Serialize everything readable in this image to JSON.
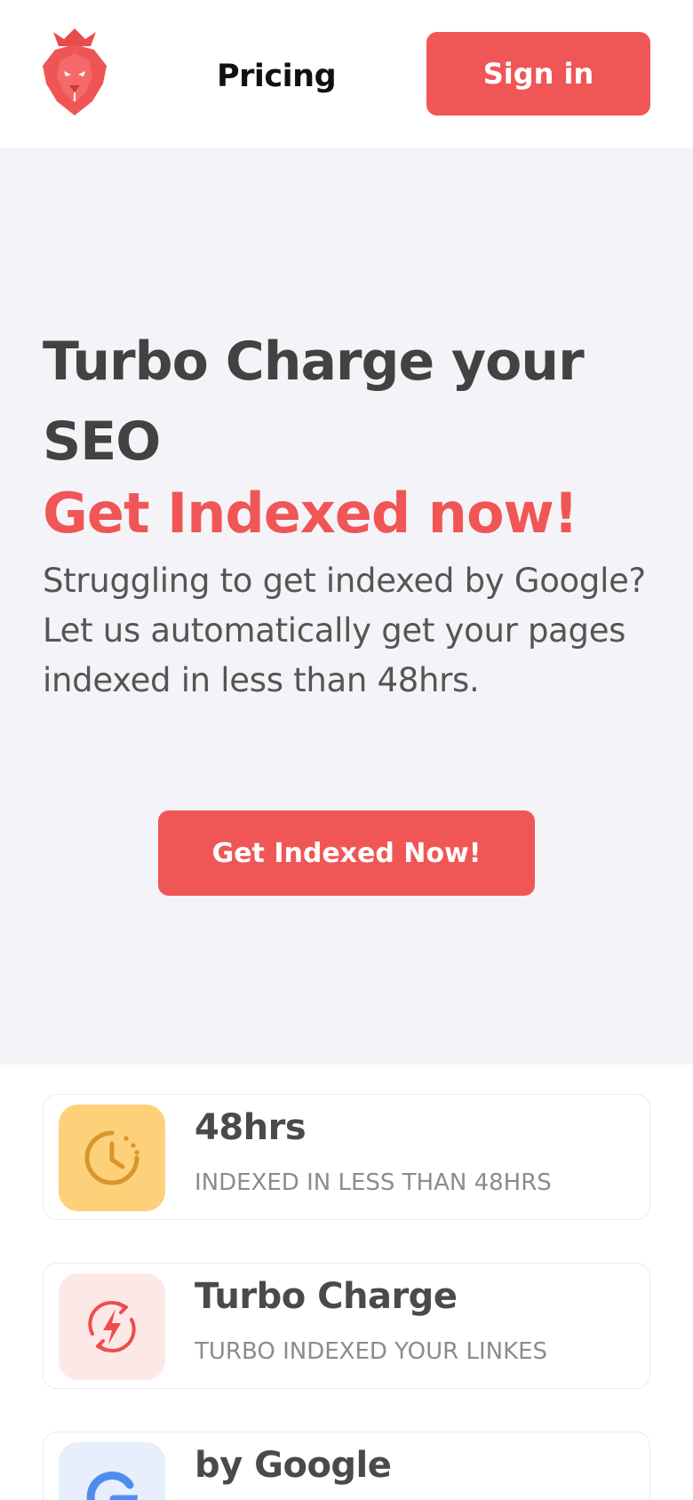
{
  "header": {
    "nav_pricing": "Pricing",
    "signin_label": "Sign in",
    "logo_icon": "crowned-lion-logo-icon"
  },
  "hero": {
    "title": "Turbo Charge your SEO",
    "accent": "Get Indexed now!",
    "description": "Struggling to get indexed by Google? Let us automatically get your pages indexed in less than 48hrs.",
    "cta_label": "Get Indexed Now!"
  },
  "features": [
    {
      "title": "48hrs",
      "subtitle": "INDEXED IN LESS THAN 48HRS",
      "icon": "clock-icon",
      "icon_bg": "#fdd17a",
      "icon_color": "#d9962a"
    },
    {
      "title": "Turbo Charge",
      "subtitle": "TURBO INDEXED YOUR LINKES",
      "icon": "lightning-icon",
      "icon_bg": "#fde8e8",
      "icon_color": "#ef4c4c"
    },
    {
      "title": "by Google",
      "subtitle": "",
      "icon": "google-g-icon",
      "icon_bg": "#e7effc",
      "icon_color": "#4f8cf0"
    }
  ],
  "colors": {
    "accent": "#f05656",
    "hero_bg": "#f4f4f8",
    "text_dark": "#424242"
  }
}
